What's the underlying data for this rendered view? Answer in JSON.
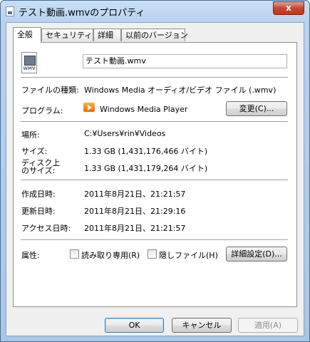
{
  "window": {
    "title": "テスト動画.wmvのプロパティ",
    "close_glyph": "x"
  },
  "tabs": [
    {
      "label": "全般",
      "active": true
    },
    {
      "label": "セキュリティ",
      "active": false
    },
    {
      "label": "詳細",
      "active": false
    },
    {
      "label": "以前のバージョン",
      "active": false
    }
  ],
  "general": {
    "file_icon_text": "WMV",
    "file_name": "テスト動画.wmv",
    "file_type_label": "ファイルの種類:",
    "file_type_value": "Windows Media オーディオ/ビデオ ファイル (.wmv)",
    "program_label": "プログラム:",
    "program_value": "Windows Media Player",
    "change_button": "変更(C)...",
    "location_label": "場所:",
    "location_value": "C:¥Users¥rin¥Videos",
    "size_label": "サイズ:",
    "size_value": "1.33 GB (1,431,176,466 バイト)",
    "disk_size_label_line1": "ディスク上",
    "disk_size_label_line2": "のサイズ:",
    "disk_size_value": "1.33 GB (1,431,179,264 バイト)",
    "created_label": "作成日時:",
    "created_value": "2011年8月21日、21:21:57",
    "modified_label": "更新日時:",
    "modified_value": "2011年8月21日、21:29:16",
    "accessed_label": "アクセス日時:",
    "accessed_value": "2011年8月21日、21:21:57",
    "attributes_label": "属性:",
    "readonly_label": "読み取り専用(R)",
    "readonly_checked": false,
    "hidden_label": "隠しファイル(H)",
    "hidden_checked": false,
    "advanced_button": "詳細設定(D)..."
  },
  "footer": {
    "ok_button": "OK",
    "cancel_button": "キャンセル",
    "apply_button": "適用(A)"
  }
}
